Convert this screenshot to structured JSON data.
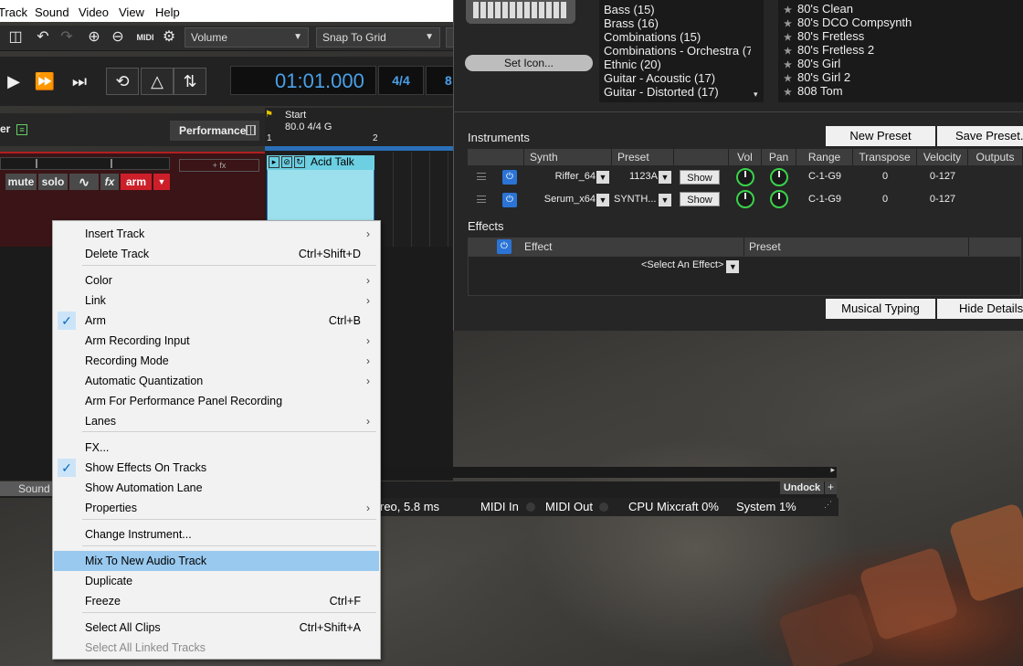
{
  "menubar": {
    "items": [
      "Track",
      "Sound",
      "Video",
      "View",
      "Help"
    ]
  },
  "toolbar": {
    "volume_dropdown": "Volume",
    "snap_dropdown": "Snap To Grid",
    "midi_icon_text": "MIDI"
  },
  "transport": {
    "time": "01:01.000",
    "meter": "4/4",
    "tempo_partial": "8"
  },
  "track": {
    "mixer_label": "er",
    "performance_button": "Performance",
    "add_fx": "+ fx",
    "mute": "mute",
    "solo": "solo",
    "fx": "fx",
    "arm": "arm"
  },
  "timeline": {
    "start_label": "Start",
    "tempo_label": "80.0 4/4 G",
    "ruler_marks": [
      "1",
      "2"
    ],
    "clip_title": "Acid Talk"
  },
  "bottom": {
    "sound_tab": "Sound",
    "undock": "Undock",
    "plus": "+"
  },
  "statusbar": {
    "audio": "reo, 5.8 ms",
    "midi_in": "MIDI In",
    "midi_out": "MIDI Out",
    "cpu": "CPU Mixcraft 0%",
    "system": "System 1%"
  },
  "rpanel": {
    "set_icon": "Set Icon...",
    "categories": [
      "Bass (15)",
      "Brass (16)",
      "Combinations (15)",
      "Combinations - Orchestra (7",
      "Ethnic (20)",
      "Guitar - Acoustic (17)",
      "Guitar - Distorted (17)"
    ],
    "presets": [
      "80's Clean",
      "80's DCO Compsynth",
      "80's Fretless",
      "80's Fretless 2",
      "80's Girl",
      "80's Girl 2",
      "808 Tom"
    ],
    "new_preset": "New Preset",
    "save_preset": "Save Preset...",
    "instruments_label": "Instruments",
    "inst_headers": [
      "Synth",
      "Preset",
      "",
      "Vol",
      "Pan",
      "Range",
      "Transpose",
      "Velocity",
      "Outputs"
    ],
    "instruments": [
      {
        "synth": "Riffer_64",
        "preset": "1123A",
        "show": "Show",
        "range": "C-1-G9",
        "transpose": "0",
        "velocity": "0-127"
      },
      {
        "synth": "Serum_x64",
        "preset": "SYNTH...",
        "show": "Show",
        "range": "C-1-G9",
        "transpose": "0",
        "velocity": "0-127"
      }
    ],
    "effects_label": "Effects",
    "effects_headers": {
      "effect": "Effect",
      "preset": "Preset"
    },
    "select_effect": "<Select An Effect>",
    "musical_typing": "Musical Typing",
    "hide_details": "Hide Details"
  },
  "context_menu": {
    "items": [
      {
        "label": "Insert Track",
        "shortcut": "",
        "submenu": true,
        "checked": false,
        "disabled": false,
        "highlighted": false
      },
      {
        "label": "Delete Track",
        "shortcut": "Ctrl+Shift+D",
        "submenu": false,
        "checked": false,
        "disabled": false,
        "highlighted": false
      },
      {
        "label": "Color",
        "shortcut": "",
        "submenu": true,
        "checked": false,
        "disabled": false,
        "highlighted": false
      },
      {
        "label": "Link",
        "shortcut": "",
        "submenu": true,
        "checked": false,
        "disabled": false,
        "highlighted": false
      },
      {
        "label": "Arm",
        "shortcut": "Ctrl+B",
        "submenu": false,
        "checked": true,
        "disabled": false,
        "highlighted": false
      },
      {
        "label": "Arm Recording Input",
        "shortcut": "",
        "submenu": true,
        "checked": false,
        "disabled": false,
        "highlighted": false
      },
      {
        "label": "Recording Mode",
        "shortcut": "",
        "submenu": true,
        "checked": false,
        "disabled": false,
        "highlighted": false
      },
      {
        "label": "Automatic Quantization",
        "shortcut": "",
        "submenu": true,
        "checked": false,
        "disabled": false,
        "highlighted": false
      },
      {
        "label": "Arm For Performance Panel Recording",
        "shortcut": "",
        "submenu": false,
        "checked": false,
        "disabled": false,
        "highlighted": false
      },
      {
        "label": "Lanes",
        "shortcut": "",
        "submenu": true,
        "checked": false,
        "disabled": false,
        "highlighted": false
      },
      {
        "label": "FX...",
        "shortcut": "",
        "submenu": false,
        "checked": false,
        "disabled": false,
        "highlighted": false
      },
      {
        "label": "Show Effects On Tracks",
        "shortcut": "",
        "submenu": false,
        "checked": true,
        "disabled": false,
        "highlighted": false
      },
      {
        "label": "Show Automation Lane",
        "shortcut": "",
        "submenu": false,
        "checked": false,
        "disabled": false,
        "highlighted": false
      },
      {
        "label": "Properties",
        "shortcut": "",
        "submenu": true,
        "checked": false,
        "disabled": false,
        "highlighted": false
      },
      {
        "label": "Change Instrument...",
        "shortcut": "",
        "submenu": false,
        "checked": false,
        "disabled": false,
        "highlighted": false
      },
      {
        "label": "Mix To New Audio Track",
        "shortcut": "",
        "submenu": false,
        "checked": false,
        "disabled": false,
        "highlighted": true
      },
      {
        "label": "Duplicate",
        "shortcut": "",
        "submenu": false,
        "checked": false,
        "disabled": false,
        "highlighted": false
      },
      {
        "label": "Freeze",
        "shortcut": "Ctrl+F",
        "submenu": false,
        "checked": false,
        "disabled": false,
        "highlighted": false
      },
      {
        "label": "Select All Clips",
        "shortcut": "Ctrl+Shift+A",
        "submenu": false,
        "checked": false,
        "disabled": false,
        "highlighted": false
      },
      {
        "label": "Select All Linked Tracks",
        "shortcut": "",
        "submenu": false,
        "checked": false,
        "disabled": true,
        "highlighted": false
      }
    ]
  },
  "colors": {
    "accent_blue": "#2b74d6",
    "arm_red": "#cc1f2a",
    "menu_highlight": "#99c9ef",
    "knob_green": "#3ad24a",
    "time_blue": "#4aa0e8"
  }
}
